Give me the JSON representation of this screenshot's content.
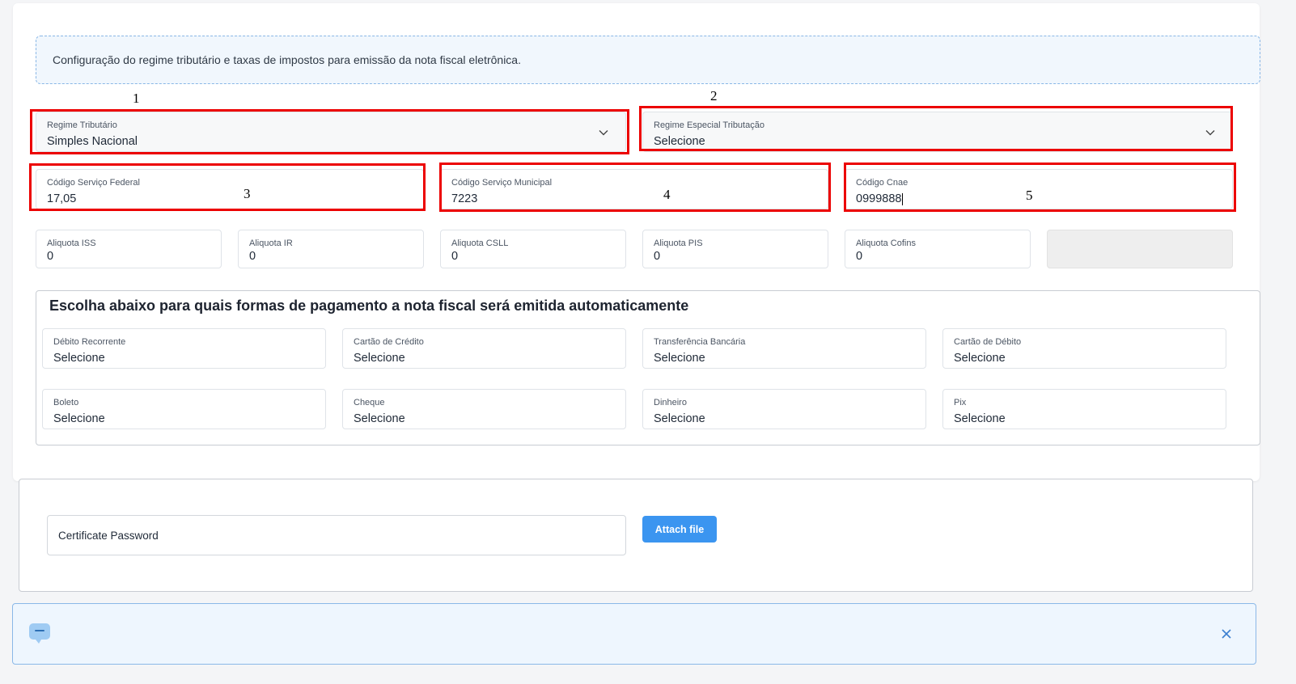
{
  "info_text": "Configuração do regime tributário e taxas de impostos para emissão da nota fiscal eletrônica.",
  "annotations": [
    "1",
    "2",
    "3",
    "4",
    "5"
  ],
  "regime": {
    "tributario": {
      "label": "Regime Tributário",
      "value": "Simples Nacional"
    },
    "especial": {
      "label": "Regime Especial Tributação",
      "value": "Selecione"
    }
  },
  "codigos": {
    "federal": {
      "label": "Código Serviço Federal",
      "value": "17,05"
    },
    "municipal": {
      "label": "Código Serviço Municipal",
      "value": "7223"
    },
    "cnae": {
      "label": "Código Cnae",
      "value": "0999888"
    }
  },
  "aliquotas": [
    {
      "label": "Aliquota ISS",
      "value": "0"
    },
    {
      "label": "Aliquota IR",
      "value": "0"
    },
    {
      "label": "Aliquota CSLL",
      "value": "0"
    },
    {
      "label": "Aliquota PIS",
      "value": "0"
    },
    {
      "label": "Aliquota Cofins",
      "value": "0"
    }
  ],
  "payment": {
    "title": "Escolha abaixo para quais formas de pagamento a nota fiscal será emitida automaticamente",
    "options": [
      {
        "label": "Débito Recorrente",
        "value": "Selecione"
      },
      {
        "label": "Cartão de Crédito",
        "value": "Selecione"
      },
      {
        "label": "Transferência Bancária",
        "value": "Selecione"
      },
      {
        "label": "Cartão de Débito",
        "value": "Selecione"
      },
      {
        "label": "Boleto",
        "value": "Selecione"
      },
      {
        "label": "Cheque",
        "value": "Selecione"
      },
      {
        "label": "Dinheiro",
        "value": "Selecione"
      },
      {
        "label": "Pix",
        "value": "Selecione"
      }
    ]
  },
  "certificate": {
    "password_placeholder": "Certificate Password",
    "attach_label": "Attach file"
  },
  "colors": {
    "accent": "#3b95f0",
    "annotation_red": "#ec0000",
    "info_bg": "#f1f7fd"
  }
}
